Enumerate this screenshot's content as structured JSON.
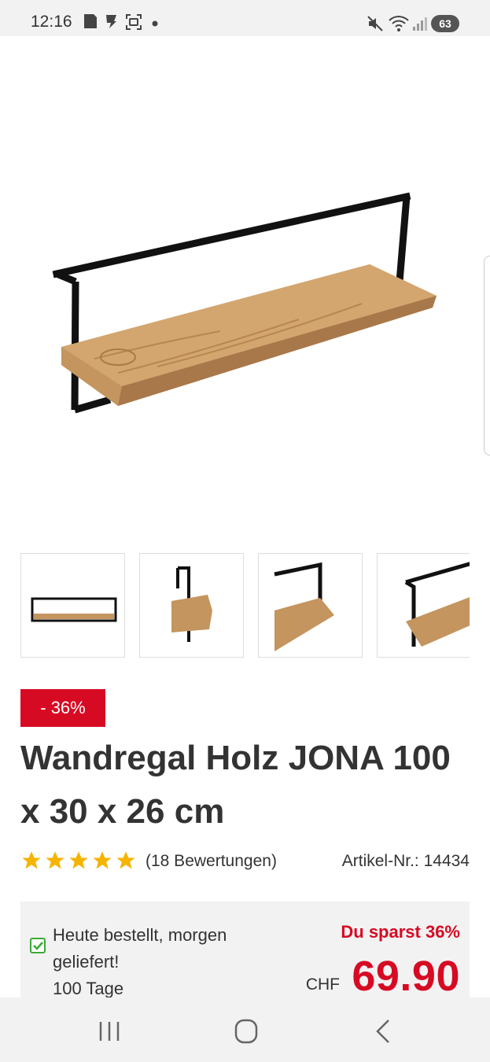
{
  "status_bar": {
    "time": "12:16",
    "battery": "63",
    "icons": [
      "gallery-icon",
      "app-icon",
      "screenshot-icon",
      "dot-icon",
      "mute-icon",
      "wifi-icon",
      "signal-icon"
    ]
  },
  "product": {
    "discount_badge": "- 36%",
    "title": "Wandregal Holz JONA 100 x 30 x 26 cm",
    "rating_stars": 5,
    "reviews": "(18 Bewertungen)",
    "article_nr": "Artikel-Nr.: 14434",
    "thumbnails": [
      "front view",
      "side view",
      "corner detail",
      "angled view"
    ]
  },
  "delivery": {
    "line": "Heute bestellt, morgen geliefert!",
    "returns": "100 Tage"
  },
  "pricing": {
    "savings": "Du sparst 36%",
    "currency": "CHF",
    "price": "69.90"
  },
  "colors": {
    "accent_red": "#d70a23",
    "star_yellow": "#f5b400",
    "check_green": "#3aaa35",
    "wood": "#c4955e",
    "metal": "#111111"
  },
  "nav_bar": {
    "buttons": [
      "recent-apps-icon",
      "home-icon",
      "back-icon"
    ]
  }
}
